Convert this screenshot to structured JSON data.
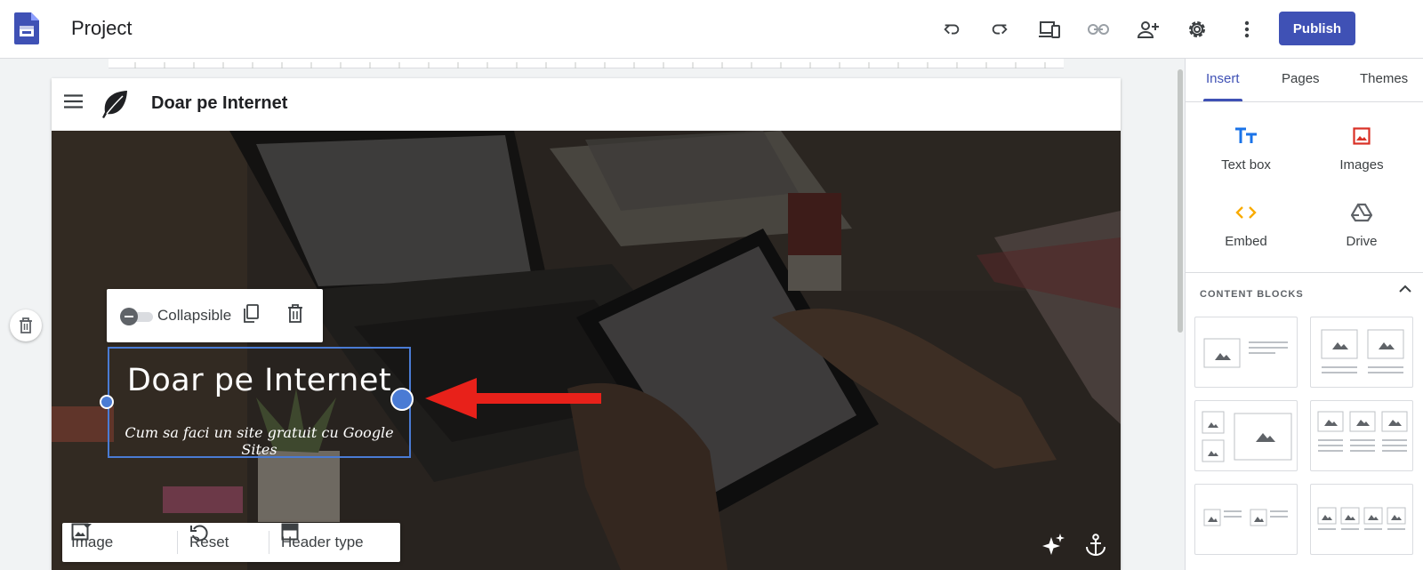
{
  "app": {
    "title": "Project",
    "publish_label": "Publish"
  },
  "toolbar_icons": [
    "undo-icon",
    "redo-icon",
    "preview-devices-icon",
    "link-icon",
    "share-icon",
    "settings-icon",
    "more-vert-icon"
  ],
  "site": {
    "name": "Doar pe Internet"
  },
  "section_toolbar": {
    "collapsible_label": "Collapsible"
  },
  "hero": {
    "title": "Doar pe Internet",
    "subtitle": "Cum sa faci un site gratuit cu Google Sites"
  },
  "bottom_toolbar": {
    "image_label": "Image",
    "reset_label": "Reset",
    "header_type_label": "Header type"
  },
  "panel": {
    "tabs": [
      {
        "label": "Insert"
      },
      {
        "label": "Pages"
      },
      {
        "label": "Themes"
      }
    ],
    "insert_items": [
      {
        "label": "Text box",
        "icon": "text-box-icon",
        "color": "#1a73e8"
      },
      {
        "label": "Images",
        "icon": "image-icon",
        "color": "#d93025"
      },
      {
        "label": "Embed",
        "icon": "embed-icon",
        "color": "#f9ab00"
      },
      {
        "label": "Drive",
        "icon": "drive-icon",
        "color": "#5f6368"
      }
    ],
    "content_blocks_heading": "CONTENT BLOCKS"
  },
  "colors": {
    "accent": "#3f51b5",
    "selection": "#4a7bd4",
    "annotation_arrow": "#e8211a"
  }
}
